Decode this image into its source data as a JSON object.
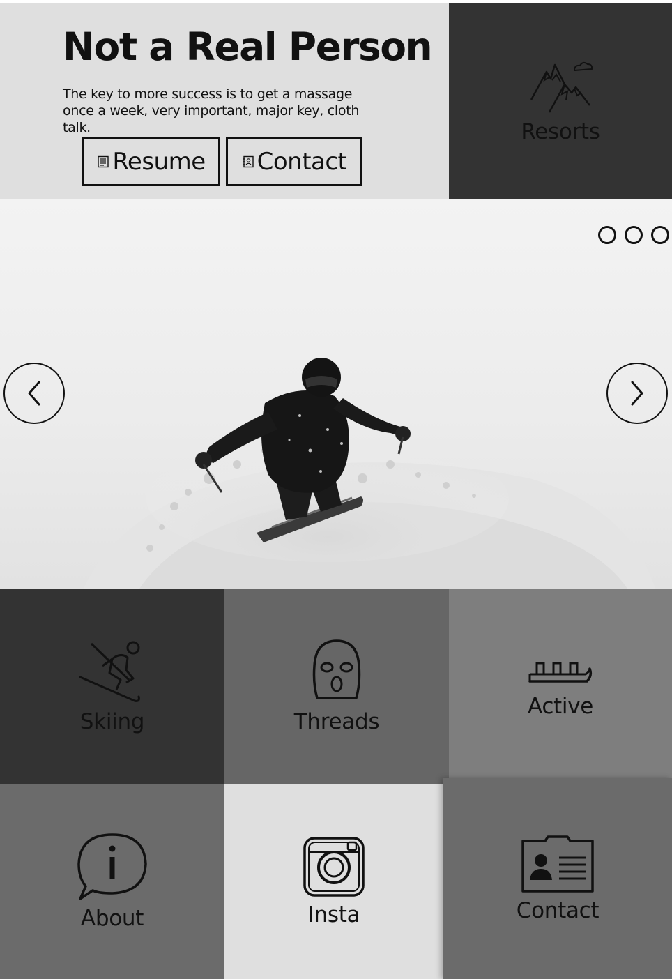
{
  "intro": {
    "title": "Not a Real Person",
    "tagline": "The key to more success is to get a massage once a week, very important, major key, cloth talk.",
    "resume_label": "Resume",
    "contact_label": "Contact"
  },
  "tiles": {
    "resorts": "Resorts",
    "skiing": "Skiing",
    "threads": "Threads",
    "active": "Active",
    "about": "About",
    "insta": "Insta",
    "contact": "Contact"
  },
  "carousel": {
    "slide_count": 3
  },
  "colors": {
    "dark_tile": "#333333",
    "mid_tile": "#666666",
    "light_tile": "#dfdfdf",
    "ink": "#111111"
  }
}
